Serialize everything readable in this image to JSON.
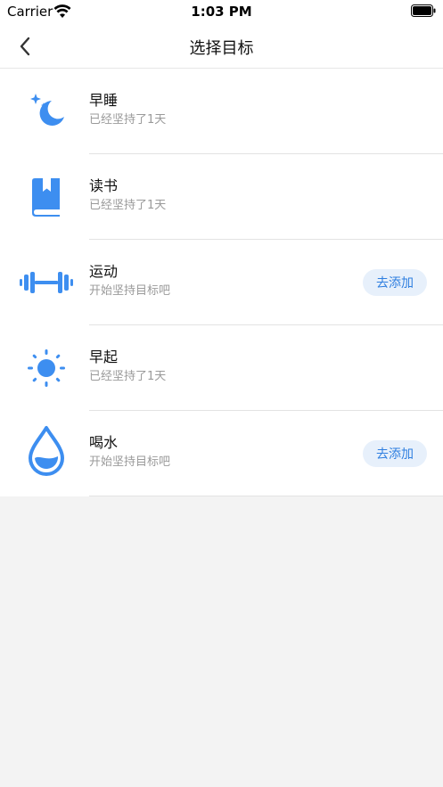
{
  "status_bar": {
    "carrier": "Carrier",
    "time": "1:03 PM"
  },
  "nav": {
    "title": "选择目标"
  },
  "colors": {
    "accent": "#2f7fe0",
    "accent_bg": "#e7f0fb",
    "icon": "#3d8ef0"
  },
  "goals": [
    {
      "icon": "moon-stars-icon",
      "title": "早睡",
      "subtitle": "已经坚持了1天",
      "action": ""
    },
    {
      "icon": "book-icon",
      "title": "读书",
      "subtitle": "已经坚持了1天",
      "action": ""
    },
    {
      "icon": "dumbbell-icon",
      "title": "运动",
      "subtitle": "开始坚持目标吧",
      "action": "去添加"
    },
    {
      "icon": "sun-icon",
      "title": "早起",
      "subtitle": "已经坚持了1天",
      "action": ""
    },
    {
      "icon": "water-drop-icon",
      "title": "喝水",
      "subtitle": "开始坚持目标吧",
      "action": "去添加"
    }
  ]
}
